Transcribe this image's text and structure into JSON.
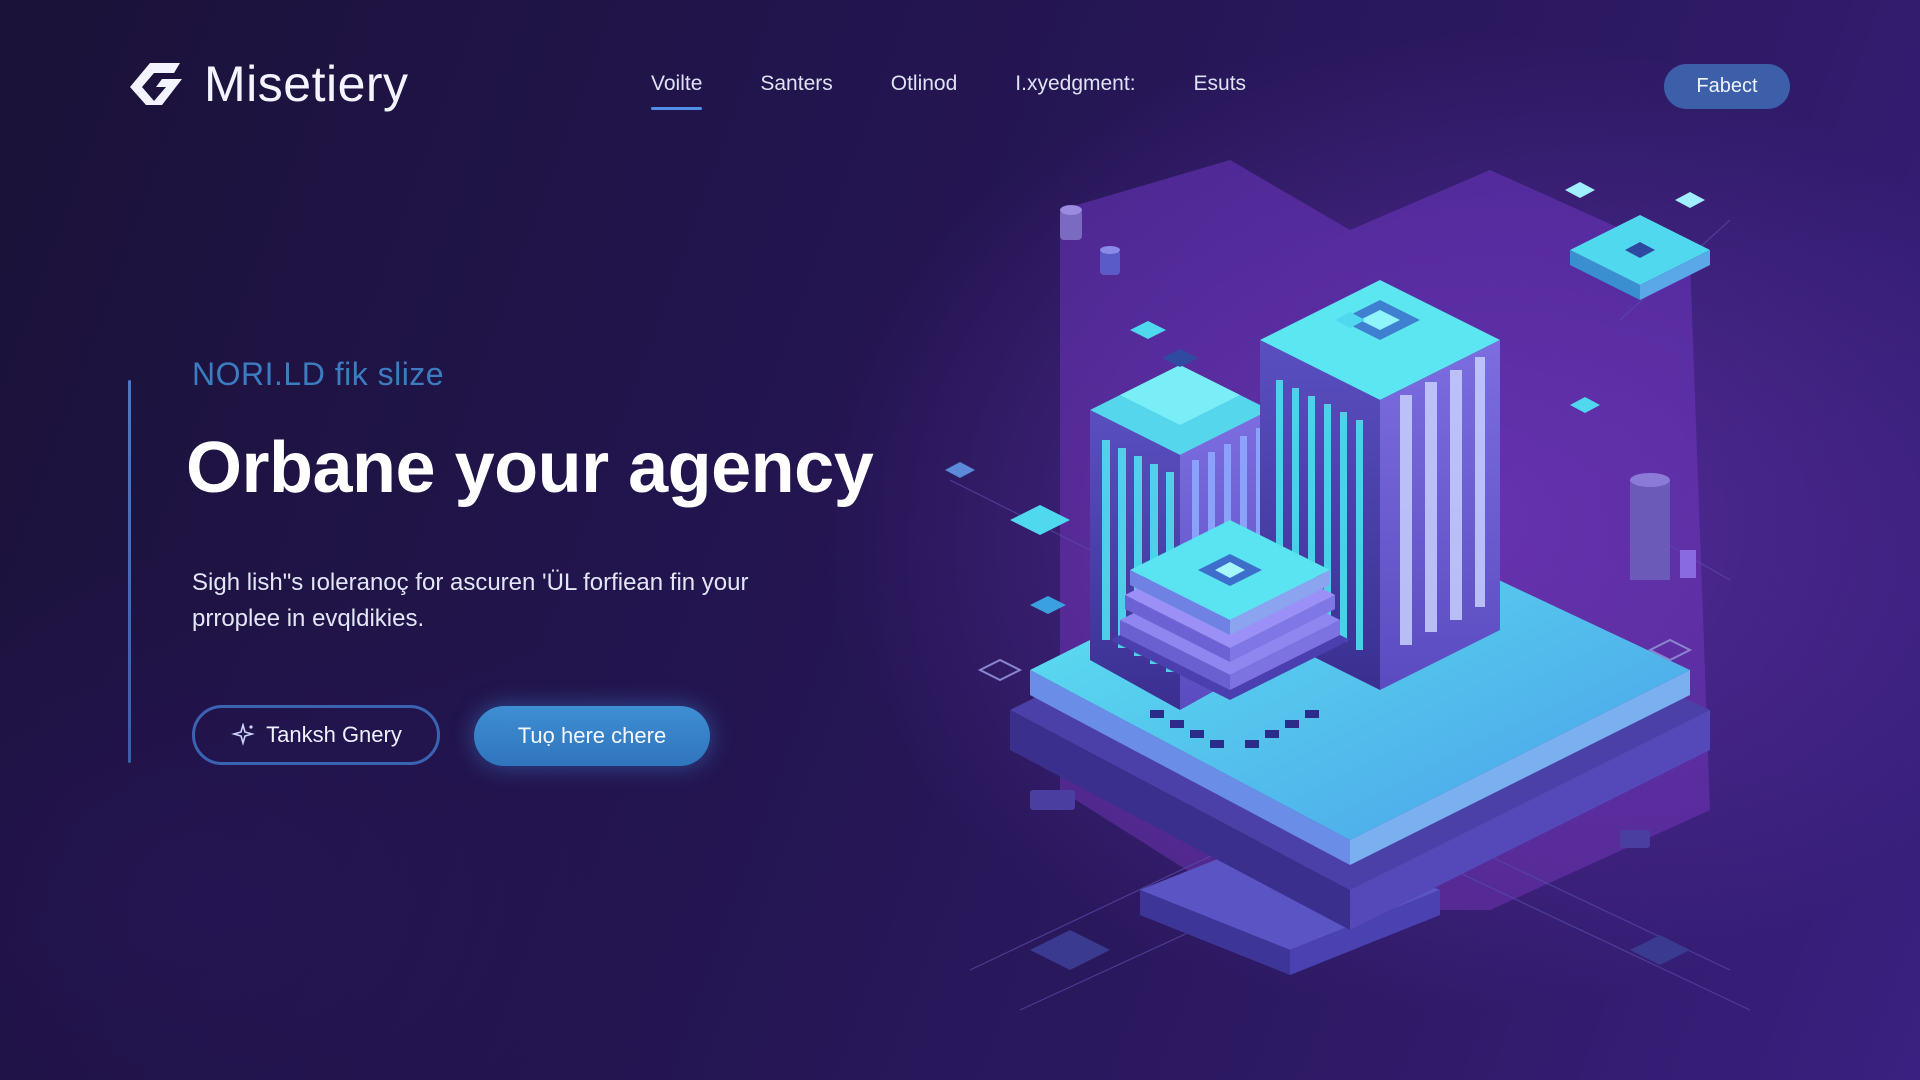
{
  "header": {
    "brand": "Misetiery",
    "nav": [
      {
        "label": "Voilte",
        "active": true
      },
      {
        "label": "Santers",
        "active": false
      },
      {
        "label": "Otlinod",
        "active": false
      },
      {
        "label": "I.xyedgment:",
        "active": false
      },
      {
        "label": "Esuts",
        "active": false
      }
    ],
    "cta": "Fabect"
  },
  "hero": {
    "eyebrow": "NORI.LD fik slize",
    "title": "Orbane your agency",
    "description_line1": "Sigh lish\"s ıoleranoç for ascuren 'ÜL forfiean fin your",
    "description_line2": "prroplee in evqldikies.",
    "primary_button": "Tanksh Gnery",
    "secondary_button": "Tuọ here chere"
  },
  "colors": {
    "accent": "#4f8fe8",
    "button_blue": "#3f8ed3",
    "cyan": "#4fe0f0",
    "purple": "#7a3fc8"
  },
  "icons": {
    "logo": "brand-mark-icon",
    "outline_button_icon": "sparkle-icon"
  }
}
